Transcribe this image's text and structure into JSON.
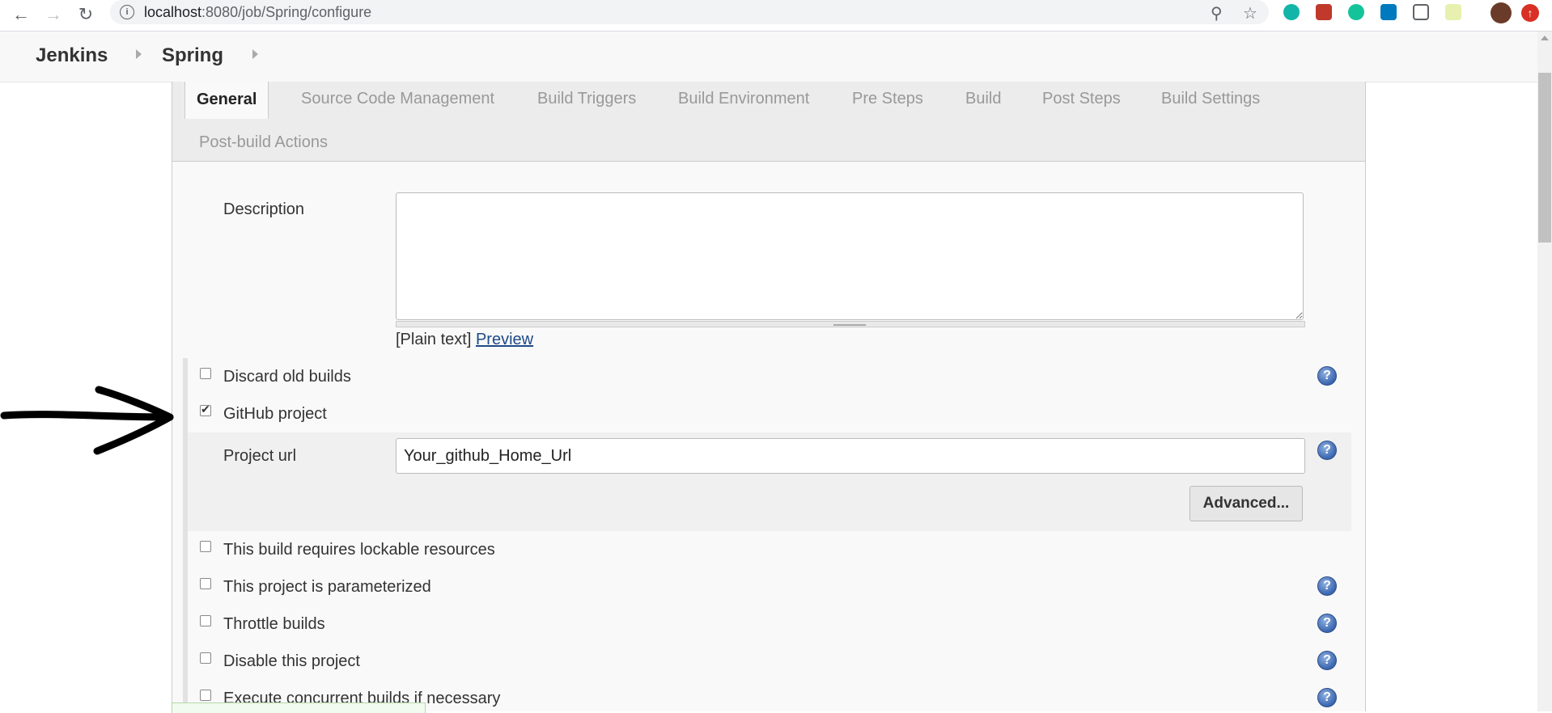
{
  "browser": {
    "url_host": "localhost",
    "url_path": ":8080/job/Spring/configure"
  },
  "breadcrumbs": [
    "Jenkins",
    "Spring"
  ],
  "tabs": [
    {
      "label": "General",
      "active": true
    },
    {
      "label": "Source Code Management"
    },
    {
      "label": "Build Triggers"
    },
    {
      "label": "Build Environment"
    },
    {
      "label": "Pre Steps"
    },
    {
      "label": "Build"
    },
    {
      "label": "Post Steps"
    },
    {
      "label": "Build Settings"
    },
    {
      "label": "Post-build Actions"
    }
  ],
  "description": {
    "label": "Description",
    "value": "",
    "plain_text": "[Plain text]",
    "preview": "Preview"
  },
  "options": [
    {
      "label": "Discard old builds",
      "checked": false,
      "help": true
    },
    {
      "label": "GitHub project",
      "checked": true,
      "help": false
    },
    {
      "label": "This build requires lockable resources",
      "checked": false,
      "help": false
    },
    {
      "label": "This project is parameterized",
      "checked": false,
      "help": true
    },
    {
      "label": "Throttle builds",
      "checked": false,
      "help": true
    },
    {
      "label": "Disable this project",
      "checked": false,
      "help": true
    },
    {
      "label": "Execute concurrent builds if necessary",
      "checked": false,
      "help": true
    }
  ],
  "github": {
    "project_url_label": "Project url",
    "project_url_value": "Your_github_Home_Url",
    "advanced_label": "Advanced..."
  },
  "help_glyph": "?",
  "colors": {
    "link": "#204a87",
    "help_icon": "#3a66b0"
  }
}
